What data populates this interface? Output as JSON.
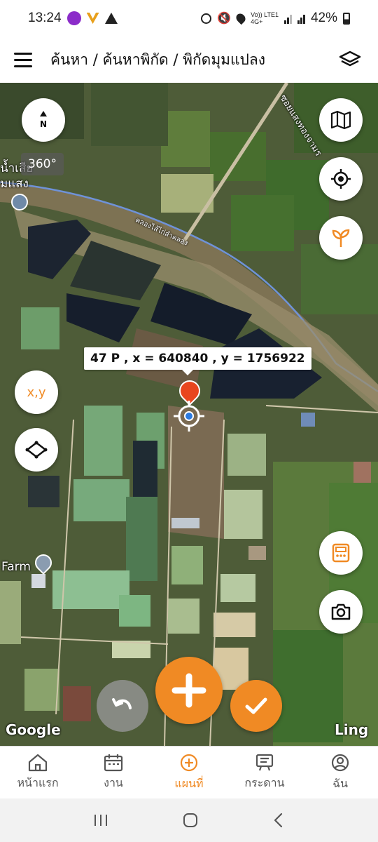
{
  "status_bar": {
    "time": "13:24",
    "battery_percent": "42%",
    "network_label_1": "Vo)) LTE1",
    "network_label_2": "4G+"
  },
  "app_bar": {
    "breadcrumb": "ค้นหา / ค้นหาพิกัด / พิกัดมุมแปลง",
    "menu_icon": "hamburger-icon",
    "layers_icon": "layers-icon"
  },
  "map": {
    "compass_label": "N",
    "view360_label": "360°",
    "place_label_1": "น้ำเสีย",
    "place_label_2": "มแสง",
    "farm_label": "Farm",
    "canal_label": "คลองไส้ไก่ลำคลอง",
    "road_label": "ซอยแสงทองจามร",
    "google_label": "Google",
    "ling_label": "Ling",
    "coordinate_label": "47 P , x = 640840 , y = 1756922",
    "xy_button_label": "x,y"
  },
  "bottom_nav": {
    "items": [
      {
        "label": "หน้าแรก",
        "icon": "home-icon"
      },
      {
        "label": "งาน",
        "icon": "calendar-icon"
      },
      {
        "label": "แผนที่",
        "icon": "map-add-icon"
      },
      {
        "label": "กระดาน",
        "icon": "board-icon"
      },
      {
        "label": "ฉัน",
        "icon": "profile-icon"
      }
    ],
    "active_index": 2
  },
  "colors": {
    "accent": "#F08A24",
    "map_base": "#4B5A35",
    "canal": "#8B7D5A",
    "pond_dark": "#1C2430"
  }
}
